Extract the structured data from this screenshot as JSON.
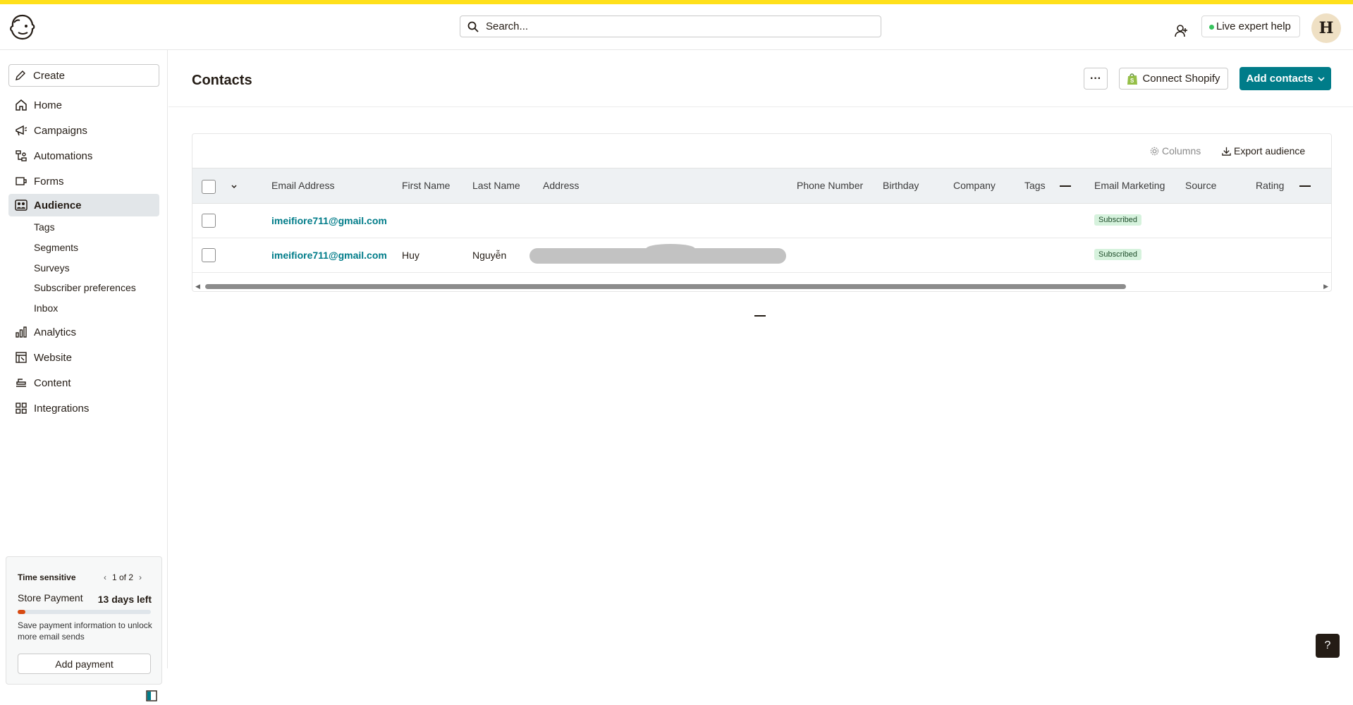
{
  "header": {
    "search_placeholder": "Search...",
    "expert_label": "Live expert help",
    "avatar_letter": "H"
  },
  "sidebar": {
    "create_label": "Create",
    "items": [
      {
        "label": "Home",
        "icon": "home-icon"
      },
      {
        "label": "Campaigns",
        "icon": "megaphone-icon"
      },
      {
        "label": "Automations",
        "icon": "flow-icon"
      },
      {
        "label": "Forms",
        "icon": "form-icon"
      },
      {
        "label": "Audience",
        "icon": "audience-icon",
        "active": true
      },
      {
        "label": "Analytics",
        "icon": "bar-chart-icon"
      },
      {
        "label": "Website",
        "icon": "website-icon"
      },
      {
        "label": "Content",
        "icon": "content-icon"
      },
      {
        "label": "Integrations",
        "icon": "grid-icon"
      }
    ],
    "subitems": [
      "Tags",
      "Segments",
      "Surveys",
      "Subscriber preferences",
      "Inbox"
    ]
  },
  "promo": {
    "label": "Time sensitive",
    "pager": "1 of 2",
    "title": "Store Payment",
    "days_left": "13 days left",
    "progress_fraction": 0.06,
    "description": "Save payment information to unlock more email sends",
    "button_label": "Add payment"
  },
  "page": {
    "title": "Contacts",
    "more_label": "···",
    "shopify_label": "Connect Shopify",
    "add_contacts_label": "Add contacts"
  },
  "table": {
    "columns_label": "Columns",
    "export_label": "Export audience",
    "headers": [
      "Email Address",
      "First Name",
      "Last Name",
      "Address",
      "Phone Number",
      "Birthday",
      "Company",
      "Tags",
      "Email Marketing",
      "Source",
      "Rating"
    ],
    "rows": [
      {
        "email": "imeifiore711@gmail.com",
        "first_name": "",
        "last_name": "",
        "email_marketing": "Subscribed"
      },
      {
        "email": "imeifiore711@gmail.com",
        "first_name": "Huy",
        "last_name": "Nguyễn",
        "email_marketing": "Subscribed"
      }
    ]
  },
  "help_label": "?",
  "colors": {
    "brand_yellow": "#ffe01b",
    "primary_teal": "#007c89",
    "progress_red": "#d74a12",
    "badge_green": "#d6f2dd"
  }
}
